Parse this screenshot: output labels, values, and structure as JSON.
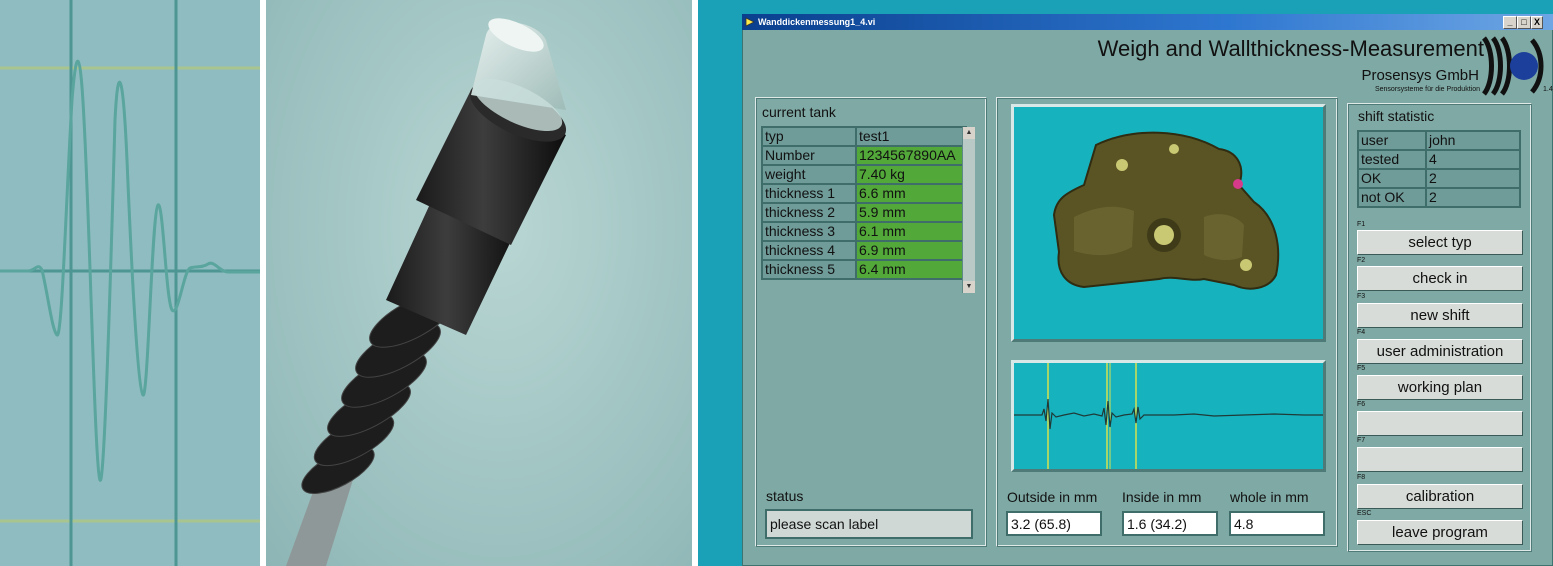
{
  "window": {
    "title": "Wanddickenmessung1_4.vi",
    "controls": [
      "_",
      "□",
      "X"
    ]
  },
  "header": {
    "title": "Weigh and Wallthickness-Measurement",
    "company": "Prosensys  GmbH",
    "company_sub": "Sensorsysteme für die Produktion",
    "version": "1.4"
  },
  "current_tank": {
    "label": "current tank",
    "rows": [
      {
        "key": "typ",
        "value": "test1"
      },
      {
        "key": "Number",
        "value": "1234567890AA"
      },
      {
        "key": "weight",
        "value": "7.40 kg"
      },
      {
        "key": "thickness 1",
        "value": "6.6 mm"
      },
      {
        "key": "thickness 2",
        "value": "5.9 mm"
      },
      {
        "key": "thickness 3",
        "value": "6.1 mm"
      },
      {
        "key": "thickness 4",
        "value": "6.9 mm"
      },
      {
        "key": "thickness 5",
        "value": "6.4 mm"
      }
    ]
  },
  "status": {
    "label": "status",
    "value": "please scan label"
  },
  "measurements": {
    "outside_label": "Outside in mm",
    "outside_value": "3.2 (65.8)",
    "inside_label": "Inside in mm",
    "inside_value": "1.6 (34.2)",
    "whole_label": "whole in mm",
    "whole_value": "4.8"
  },
  "shift_statistic": {
    "label": "shift statistic",
    "rows": [
      {
        "key": "user",
        "value": "john"
      },
      {
        "key": "tested",
        "value": "4"
      },
      {
        "key": "OK",
        "value": "2"
      },
      {
        "key": "not OK",
        "value": "2"
      }
    ]
  },
  "function_buttons": [
    {
      "key": "F1",
      "label": "select typ"
    },
    {
      "key": "F2",
      "label": "check in"
    },
    {
      "key": "F3",
      "label": "new shift"
    },
    {
      "key": "F4",
      "label": "user administration"
    },
    {
      "key": "F5",
      "label": "working plan"
    },
    {
      "key": "F6",
      "label": ""
    },
    {
      "key": "F7",
      "label": ""
    },
    {
      "key": "F8",
      "label": "calibration"
    },
    {
      "key": "ESC",
      "label": "leave program"
    }
  ],
  "colors": {
    "vi_background": "#7fa9a4",
    "value_cell_green": "#53a83a",
    "image_area_cyan": "#16b3bf",
    "desktop_blue": "#1aa0b7",
    "titlebar_blue": "#0a3f8e"
  }
}
